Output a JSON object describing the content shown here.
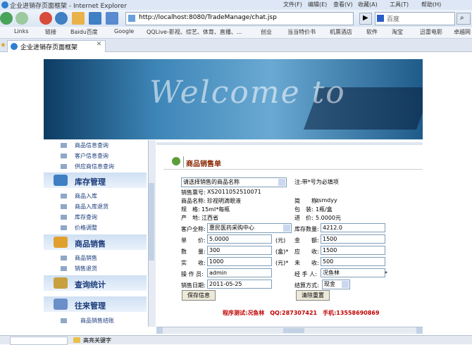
{
  "window": {
    "title": "企业进销存页面框架 - Internet Explorer",
    "menu": [
      "文件(F)",
      "编辑(E)",
      "查看(V)",
      "收藏(A)",
      "工具(T)",
      "帮助(H)"
    ]
  },
  "address": {
    "url": "http://localhost:8080/TradeManage/chat.jsp",
    "search_placeholder": "百度"
  },
  "links": [
    "Links",
    "链接",
    "Baidu百度",
    "Google",
    "QQLive-影视、综艺、体育、直播、...",
    "创业",
    "当当特价书",
    "机票酒店",
    "软件",
    "淘宝",
    "迅雷电影",
    "卓越网"
  ],
  "tab": {
    "label": "企业进销存页面框架"
  },
  "banner": {
    "text": "Welcome to"
  },
  "sidebar": {
    "top_items": [
      "商品信息查询",
      "客户信息查询",
      "供应商信息查询"
    ],
    "inventory": {
      "title": "库存管理",
      "items": [
        "商品入库",
        "商品入库退货",
        "库存查询",
        "价格调整"
      ]
    },
    "sales": {
      "title": "商品销售",
      "items": [
        "商品销售",
        "销售退货"
      ]
    },
    "query": {
      "title": "查询统计"
    },
    "dealings": {
      "title": "往来管理",
      "items": [
        "商品销售结账"
      ]
    }
  },
  "form": {
    "title": "商品销售单",
    "product_select": "请选择销售的商品名称",
    "note": "注:带*号为必填项",
    "sale_no_label": "销售票号:",
    "sale_no": "XS2011052510071",
    "name_label": "商品名称:",
    "name": "珍视明滴眼液",
    "short_label": "简　　称:",
    "short": "zsmdyy",
    "spec_label": "规　格:",
    "spec": "15ml*每瓶",
    "pack_label": "包　装:",
    "pack": "1瓶/盒",
    "origin_label": "产　地:",
    "origin": "江西省",
    "in_price_label": "进　价:",
    "in_price": "5.0000元",
    "customer_label": "客户全称:",
    "customer": "惠民医药采购中心",
    "stock_label": "库存数量:",
    "stock": "4212.0",
    "unit_price_label": "单　　价:",
    "unit_price": "5.0000",
    "yuan": "(元)",
    "amount_label": "金　　额:",
    "amount": "1500",
    "qty_label": "数　　量:",
    "qty": "300",
    "box": "(盒)*",
    "receivable_label": "应　　收:",
    "receivable": "1500",
    "received_label": "实　　收:",
    "received": "1000",
    "yuan_star": "(元)*",
    "unreceived_label": "未　　收:",
    "unreceived": "500",
    "operator_label": "操 作 员:",
    "operator": "admin",
    "handler_label": "经 手 人:",
    "handler": "况鱼林",
    "star": "*",
    "date_label": "销售日期:",
    "date": "2011-05-25",
    "settle_label": "结算方式:",
    "settle": "现金",
    "save_button": "保存信息",
    "reset_button": "清除重置",
    "test_line": "程序测试:况鱼林　QQ:287307421　手机:13558690869"
  },
  "status": {
    "text": "高亮关键字"
  }
}
